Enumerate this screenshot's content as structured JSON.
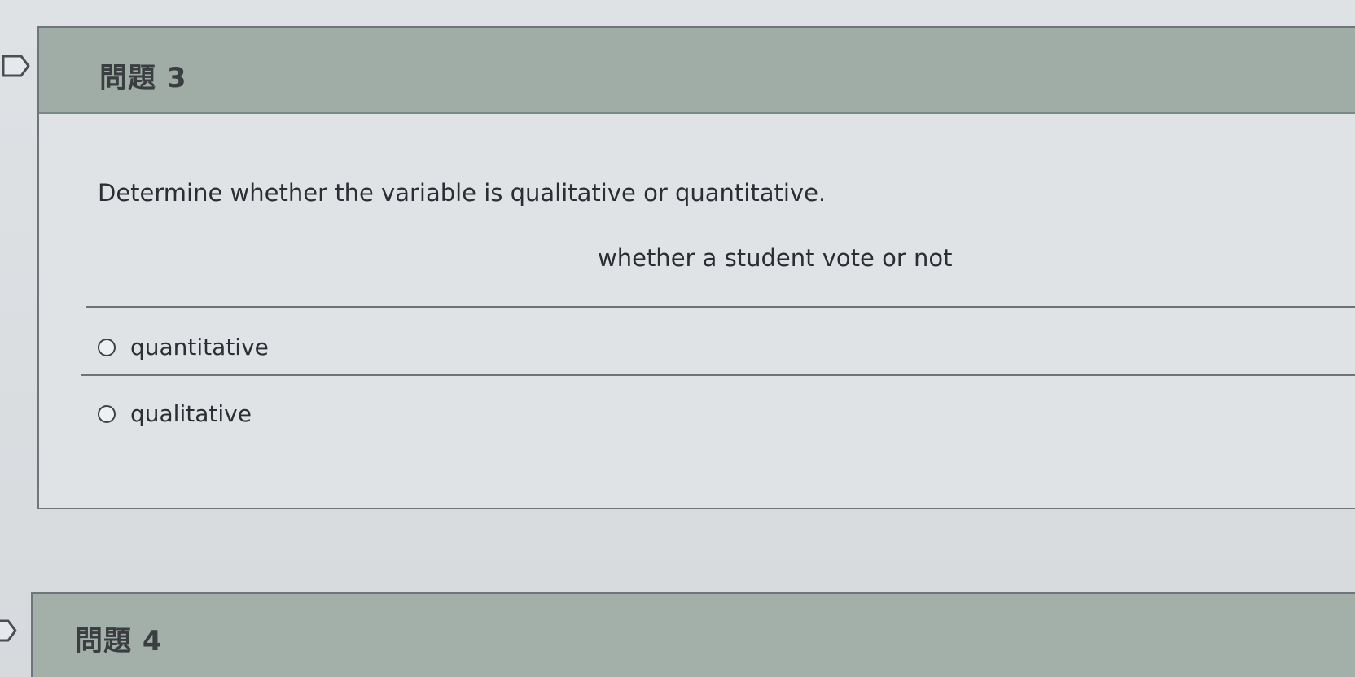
{
  "questions": [
    {
      "title": "問題 3",
      "prompt": "Determine whether the variable is qualitative or quantitative.",
      "variable": "whether a student vote or not",
      "options": [
        {
          "label": "quantitative",
          "selected": false
        },
        {
          "label": "qualitative",
          "selected": false
        }
      ]
    },
    {
      "title": "問題 4"
    }
  ],
  "colors": {
    "header_bg": "#9fada6",
    "body_bg": "#dfe3e6",
    "border": "#707579",
    "text": "#2b2f33"
  },
  "icons": [
    "flag-outline-icon",
    "radio-unselected-icon"
  ]
}
